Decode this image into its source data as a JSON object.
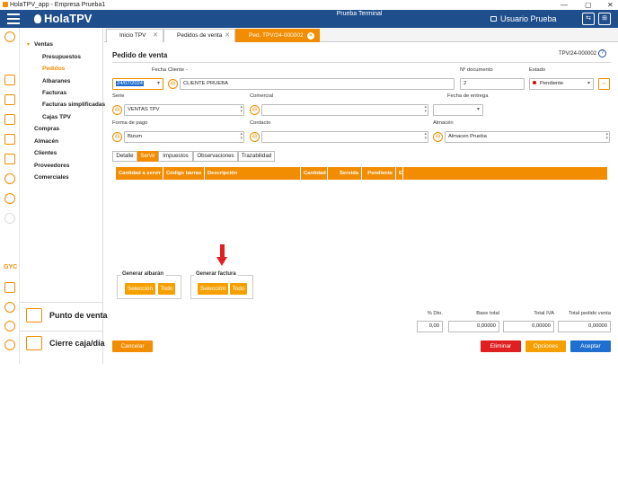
{
  "window": {
    "title": "HolaTPV_app - Empresa Prueba1",
    "min": "—",
    "max": "▢",
    "close": "✕"
  },
  "header": {
    "app_name": "HolaTPV",
    "terminal": "Prueba Terminal",
    "user": "Usuario Prueba",
    "btn1": "⇆",
    "btn2": "⊞"
  },
  "sidebar": {
    "section": "Ventas",
    "sub_items": [
      "Presupuestos",
      "Pedidos",
      "Albaranes",
      "Facturas",
      "Facturas simplificadas",
      "Cajas TPV"
    ],
    "active_item": "Pedidos",
    "main_items": [
      "Compras",
      "Almacén",
      "Clientes",
      "Proveedores",
      "Comerciales"
    ],
    "gyc": "GYC",
    "pos_button": "Punto de venta",
    "close_button": "Cierre caja/día"
  },
  "tabs": [
    {
      "label": "Inicio TPV"
    },
    {
      "label": "Pedidos de venta"
    },
    {
      "label": "Ped. TPV/24-000002"
    }
  ],
  "form": {
    "title": "Pedido de venta",
    "doc_id": "TPV/24-000002",
    "fecha_label": "Fecha",
    "fecha_value": "24/07/2024",
    "cliente_label": "Cliente",
    "cliente_marker": "-",
    "cliente_value": "CLIENTE PRUEBA",
    "ndoc_label": "Nº documento",
    "ndoc_value": "2",
    "estado_label": "Estado",
    "estado_value": "Pendiente",
    "serie_label": "Serie",
    "serie_value": "VENTAS TPV",
    "comercial_label": "Comercial",
    "comercial_value": "",
    "fecha_entrega_label": "Fecha de entrega",
    "fecha_entrega_value": "",
    "forma_pago_label": "Forma de pago",
    "forma_pago_value": "Bizum",
    "contacto_label": "Contacto",
    "contacto_value": "",
    "almacen_label": "Almacén",
    "almacen_value": "Almacen Prueba",
    "help": "?"
  },
  "subtabs": [
    "Detalle",
    "Servir",
    "Impuestos",
    "Observaciones",
    "Trazabilidad"
  ],
  "active_subtab": "Servir",
  "grid_columns": [
    "Cantidad a servir",
    "Código barras",
    "Descripción",
    "Cantidad",
    "Servida",
    "Pendiente",
    "E"
  ],
  "generar_albaran": {
    "title": "Generar albarán",
    "seleccion": "Selección",
    "todo": "Todo"
  },
  "generar_factura": {
    "title": "Generar factura",
    "seleccion": "Selección",
    "todo": "Todo"
  },
  "totals": {
    "dto_label": "% Dto.",
    "dto_value": "0,00",
    "base_label": "Base total",
    "base_value": "0,00000",
    "iva_label": "Total IVA",
    "iva_value": "0,00000",
    "total_label": "Total pedido venta",
    "total_value": "0,00000"
  },
  "buttons": {
    "cancelar": "Cancelar",
    "eliminar": "Eliminar",
    "opciones": "Opciones",
    "aceptar": "Aceptar"
  },
  "colors": {
    "header": "#1f4e8c",
    "accent": "#f28c00",
    "danger": "#e02020",
    "primary": "#1f6fd0",
    "arrow": "#e02020"
  }
}
